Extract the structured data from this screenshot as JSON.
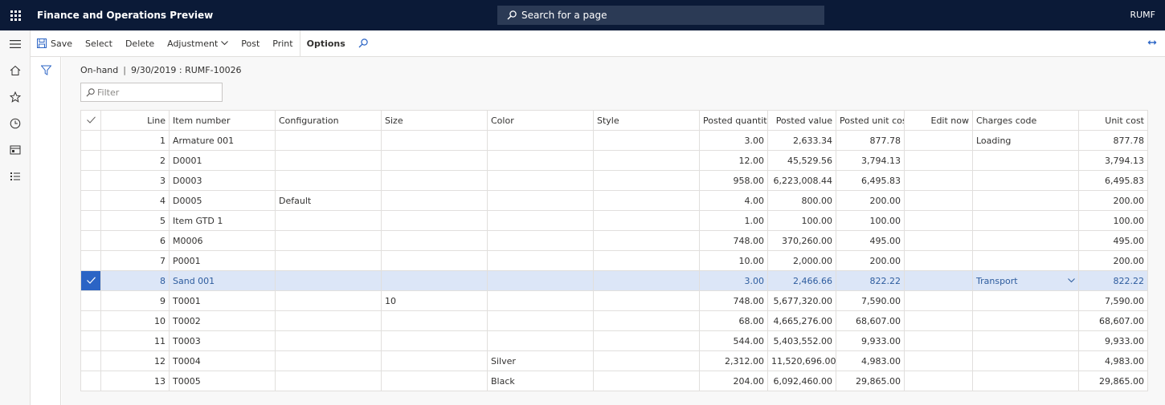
{
  "app": {
    "title": "Finance and Operations Preview",
    "company": "RUMF"
  },
  "search": {
    "placeholder": "Search for a page"
  },
  "actions": {
    "save": "Save",
    "select": "Select",
    "delete": "Delete",
    "adjustment": "Adjustment",
    "post": "Post",
    "print": "Print",
    "options": "Options"
  },
  "breadcrumb": {
    "section": "On-hand",
    "detail": "9/30/2019 : RUMF-10026"
  },
  "filter": {
    "placeholder": "Filter"
  },
  "table": {
    "headers": {
      "line": "Line",
      "item": "Item number",
      "config": "Configuration",
      "size": "Size",
      "color": "Color",
      "style": "Style",
      "qty": "Posted quantity",
      "value": "Posted value",
      "unitcost": "Posted unit cost",
      "editnow": "Edit now",
      "charges": "Charges code",
      "unit": "Unit cost"
    },
    "rows": [
      {
        "line": "1",
        "item": "Armature 001",
        "config": "",
        "size": "",
        "color": "",
        "style": "",
        "qty": "3.00",
        "value": "2,633.34",
        "unitcost": "877.78",
        "editnow": "",
        "charges": "Loading",
        "unit": "877.78"
      },
      {
        "line": "2",
        "item": "D0001",
        "config": "",
        "size": "",
        "color": "",
        "style": "",
        "qty": "12.00",
        "value": "45,529.56",
        "unitcost": "3,794.13",
        "editnow": "",
        "charges": "",
        "unit": "3,794.13"
      },
      {
        "line": "3",
        "item": "D0003",
        "config": "",
        "size": "",
        "color": "",
        "style": "",
        "qty": "958.00",
        "value": "6,223,008.44",
        "unitcost": "6,495.83",
        "editnow": "",
        "charges": "",
        "unit": "6,495.83"
      },
      {
        "line": "4",
        "item": "D0005",
        "config": "Default",
        "size": "",
        "color": "",
        "style": "",
        "qty": "4.00",
        "value": "800.00",
        "unitcost": "200.00",
        "editnow": "",
        "charges": "",
        "unit": "200.00"
      },
      {
        "line": "5",
        "item": "Item GTD 1",
        "config": "",
        "size": "",
        "color": "",
        "style": "",
        "qty": "1.00",
        "value": "100.00",
        "unitcost": "100.00",
        "editnow": "",
        "charges": "",
        "unit": "100.00"
      },
      {
        "line": "6",
        "item": "M0006",
        "config": "",
        "size": "",
        "color": "",
        "style": "",
        "qty": "748.00",
        "value": "370,260.00",
        "unitcost": "495.00",
        "editnow": "",
        "charges": "",
        "unit": "495.00"
      },
      {
        "line": "7",
        "item": "P0001",
        "config": "",
        "size": "",
        "color": "",
        "style": "",
        "qty": "10.00",
        "value": "2,000.00",
        "unitcost": "200.00",
        "editnow": "",
        "charges": "",
        "unit": "200.00"
      },
      {
        "line": "8",
        "item": "Sand 001",
        "config": "",
        "size": "",
        "color": "",
        "style": "",
        "qty": "3.00",
        "value": "2,466.66",
        "unitcost": "822.22",
        "editnow": "",
        "charges": "Transport",
        "unit": "822.22"
      },
      {
        "line": "9",
        "item": "T0001",
        "config": "",
        "size": "10",
        "color": "",
        "style": "",
        "qty": "748.00",
        "value": "5,677,320.00",
        "unitcost": "7,590.00",
        "editnow": "",
        "charges": "",
        "unit": "7,590.00"
      },
      {
        "line": "10",
        "item": "T0002",
        "config": "",
        "size": "",
        "color": "",
        "style": "",
        "qty": "68.00",
        "value": "4,665,276.00",
        "unitcost": "68,607.00",
        "editnow": "",
        "charges": "",
        "unit": "68,607.00"
      },
      {
        "line": "11",
        "item": "T0003",
        "config": "",
        "size": "",
        "color": "",
        "style": "",
        "qty": "544.00",
        "value": "5,403,552.00",
        "unitcost": "9,933.00",
        "editnow": "",
        "charges": "",
        "unit": "9,933.00"
      },
      {
        "line": "12",
        "item": "T0004",
        "config": "",
        "size": "",
        "color": "Silver",
        "style": "",
        "qty": "2,312.00",
        "value": "11,520,696.00",
        "unitcost": "4,983.00",
        "editnow": "",
        "charges": "",
        "unit": "4,983.00"
      },
      {
        "line": "13",
        "item": "T0005",
        "config": "",
        "size": "",
        "color": "Black",
        "style": "",
        "qty": "204.00",
        "value": "6,092,460.00",
        "unitcost": "29,865.00",
        "editnow": "",
        "charges": "",
        "unit": "29,865.00"
      }
    ],
    "selected_line": "8"
  },
  "colors": {
    "topbar": "#0b1a37",
    "accent": "#2b64c5",
    "selected_row": "#dce6f7"
  },
  "icons": [
    "waffle-icon",
    "search-icon",
    "hamburger-icon",
    "home-icon",
    "star-icon",
    "clock-icon",
    "workspace-icon",
    "list-icon",
    "save-icon",
    "chevron-down-icon",
    "funnel-icon",
    "expand-icon",
    "checkmark-icon"
  ]
}
